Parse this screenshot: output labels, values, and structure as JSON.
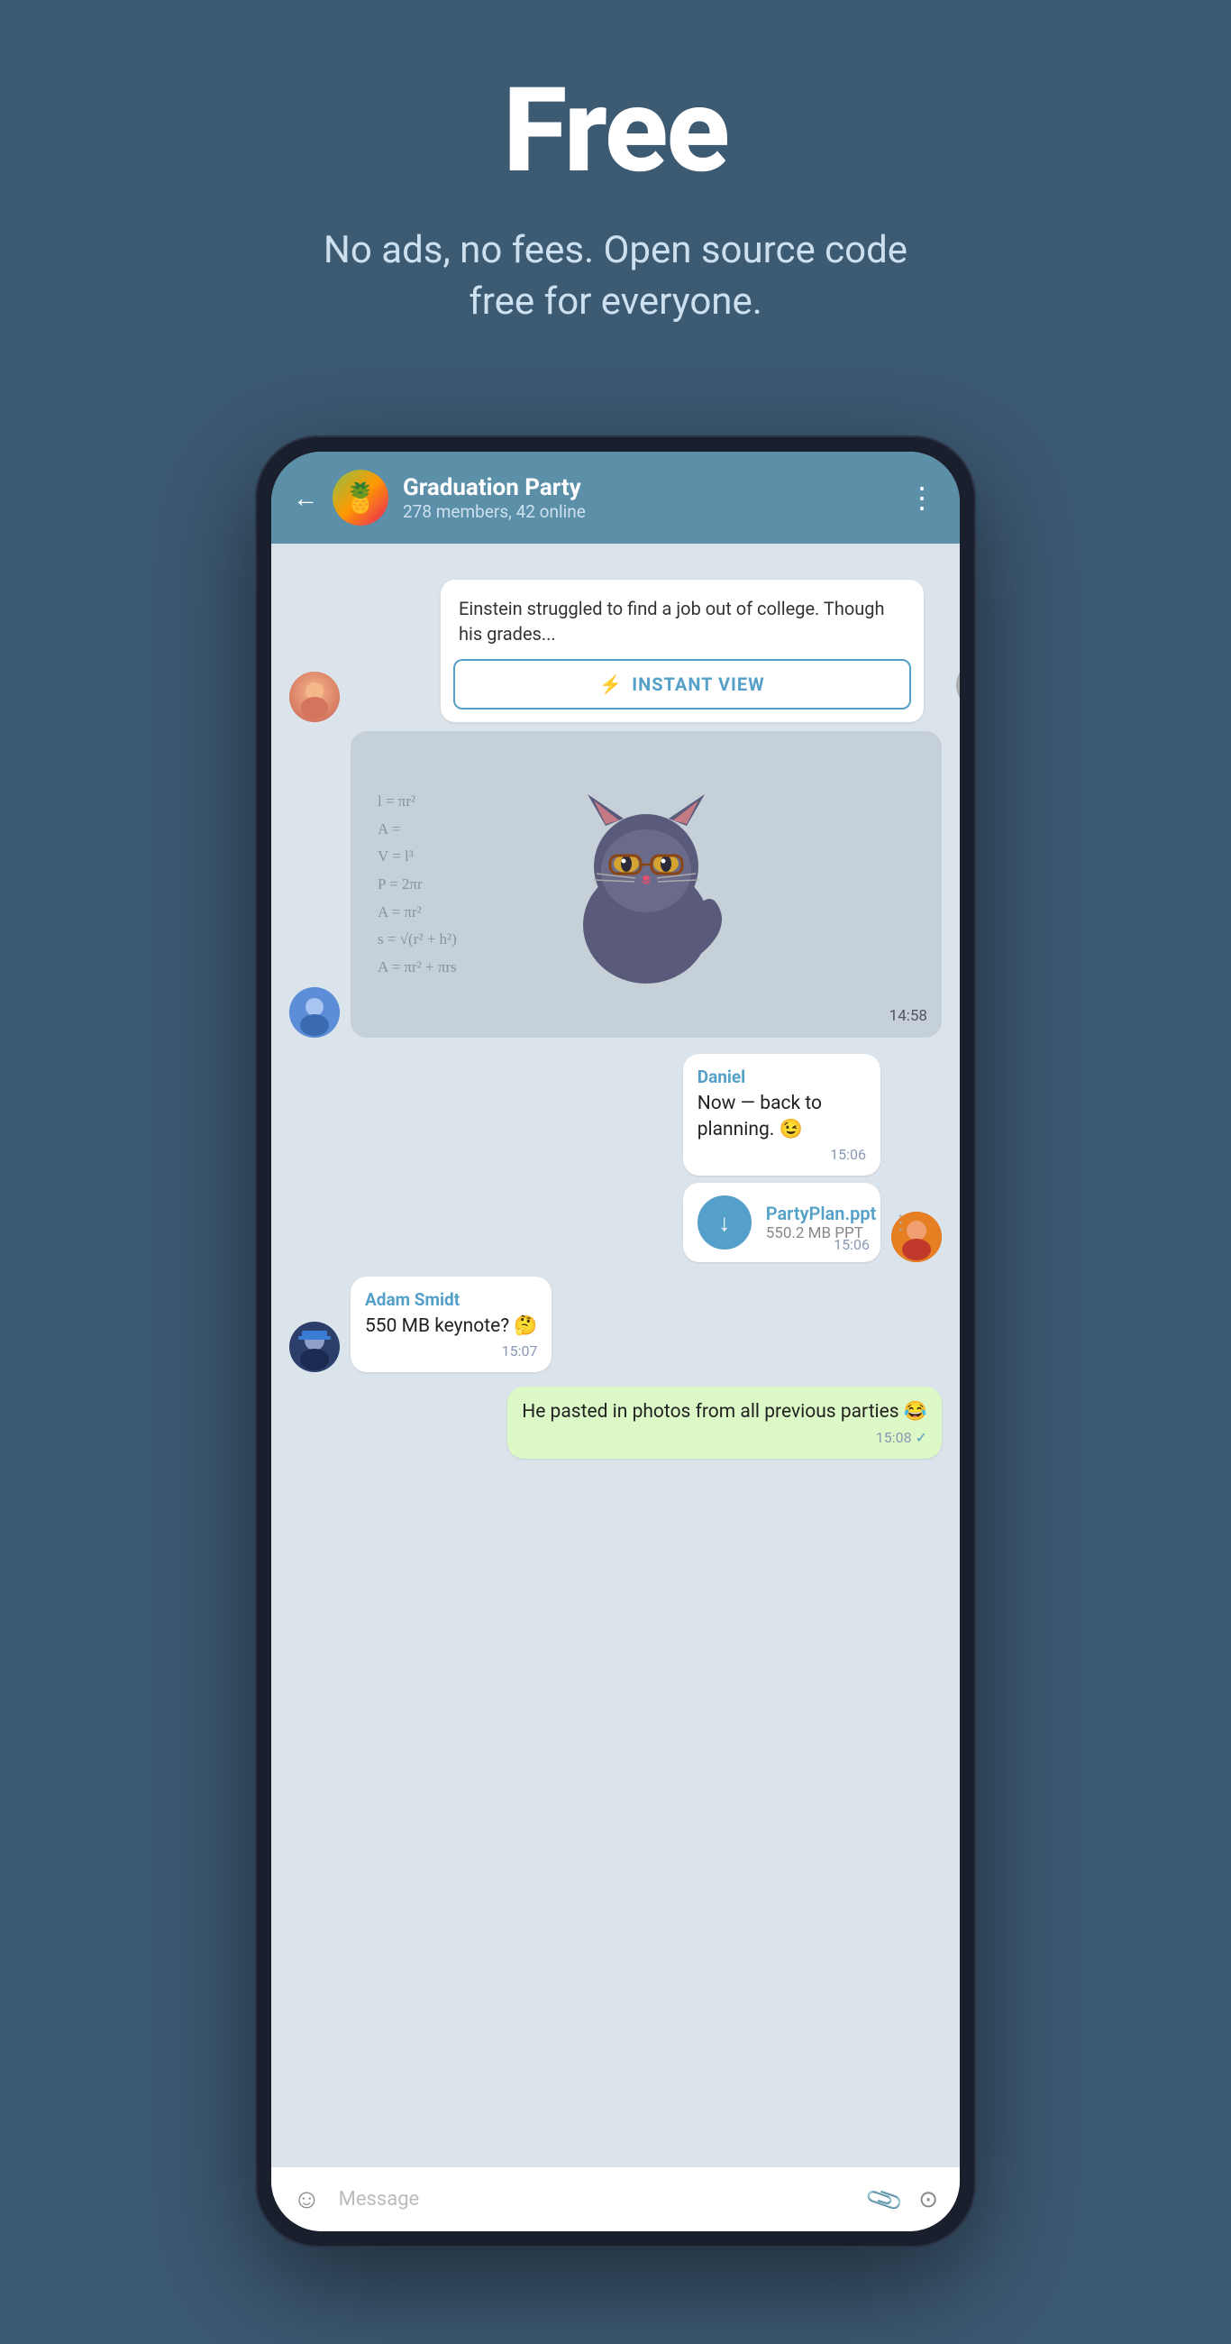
{
  "hero": {
    "title": "Free",
    "subtitle": "No ads, no fees. Open source code free for everyone."
  },
  "header": {
    "back_label": "←",
    "group_name": "Graduation Party",
    "members": "278 members, 42 online",
    "menu_dots": "⋮",
    "avatar_emoji": "🍍"
  },
  "article": {
    "preview_text": "Einstein struggled to find a job out of college. Though his grades...",
    "instant_view_label": "INSTANT VIEW"
  },
  "sticker": {
    "time": "14:58"
  },
  "messages": [
    {
      "sender": "Daniel",
      "text": "Now — back to planning. 😉",
      "time": "15:06",
      "type": "text",
      "side": "right"
    },
    {
      "file_name": "PartyPlan.ppt",
      "file_size": "550.2 MB PPT",
      "time": "15:06",
      "type": "file",
      "side": "right"
    },
    {
      "sender": "Adam Smidt",
      "text": "550 MB keynote? 🤔",
      "time": "15:07",
      "type": "text",
      "side": "left"
    },
    {
      "text": "He pasted in photos from all previous parties 😂",
      "time": "15:08",
      "type": "text",
      "side": "own",
      "ticked": true
    }
  ],
  "input": {
    "placeholder": "Message",
    "emoji_icon": "emoji",
    "attach_icon": "paperclip",
    "camera_icon": "camera"
  }
}
